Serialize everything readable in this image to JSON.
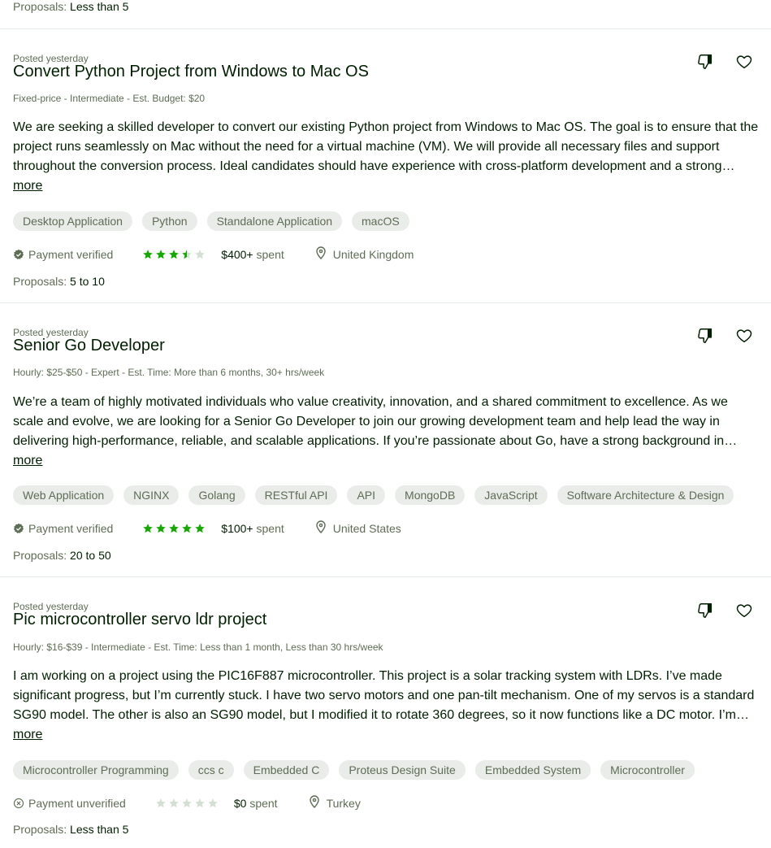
{
  "top": {
    "proposals_label": "Proposals:",
    "proposals_value": "Less than 5"
  },
  "jobs": [
    {
      "posted": "Posted yesterday",
      "title": "Convert Python Project from Windows to Mac OS",
      "meta": "Fixed-price - Intermediate - Est. Budget: $20",
      "description": "We are seeking a skilled developer to convert our existing Python project from Windows to Mac OS. The goal is to ensure that the project runs seamlessly on Mac without the need for a virtual machine (VM). We will provide all necessary files and support throughout the conversion process. Ideal candidates should have experience with cross-platform development and a strong understanding of both operating systems.",
      "more_label": "more",
      "tags": [
        "Desktop Application",
        "Python",
        "Standalone Application",
        "macOS"
      ],
      "payment": "Payment verified",
      "payment_verified": true,
      "rating": 3.5,
      "spent_amount": "$400+",
      "spent_label": "spent",
      "location": "United Kingdom",
      "proposals_label": "Proposals:",
      "proposals_value": "5 to 10"
    },
    {
      "posted": "Posted yesterday",
      "title": "Senior Go Developer",
      "meta": "Hourly: $25-$50 - Expert - Est. Time: More than 6 months, 30+ hrs/week",
      "description": "We’re a team of highly motivated individuals who value creativity, innovation, and a shared commitment to excellence. As we scale and evolve, we are looking for a Senior Go Developer to join our growing development team and help lead the way in delivering high-performance, reliable, and scalable applications. If you’re passionate about Go, have a strong background in building backend services.",
      "more_label": "more",
      "tags": [
        "Web Application",
        "NGINX",
        "Golang",
        "RESTful API",
        "API",
        "MongoDB",
        "JavaScript",
        "Software Architecture & Design"
      ],
      "payment": "Payment verified",
      "payment_verified": true,
      "rating": 5,
      "spent_amount": "$100+",
      "spent_label": "spent",
      "location": "United States",
      "proposals_label": "Proposals:",
      "proposals_value": "20 to 50"
    },
    {
      "posted": "Posted yesterday",
      "title": "Pic microcontroller servo ldr project",
      "meta": "Hourly: $16-$39 - Intermediate - Est. Time: Less than 1 month, Less than 30 hrs/week",
      "description": "I am working on a project using the PIC16F887 microcontroller. This project is a solar tracking system with LDRs. I’ve made significant progress, but I’m currently stuck. I have two servo motors and one pan-tilt mechanism. One of my servos is a standard SG90 model. The other is also an SG90 model, but I modified it to rotate 360 degrees, so it now functions like a DC motor. I’m struggling with the code.",
      "more_label": "more",
      "tags": [
        "Microcontroller Programming",
        "ccs c",
        "Embedded C",
        "Proteus Design Suite",
        "Embedded System",
        "Microcontroller"
      ],
      "payment": "Payment unverified",
      "payment_verified": false,
      "rating": 0,
      "spent_amount": "$0",
      "spent_label": "spent",
      "location": "Turkey",
      "proposals_label": "Proposals:",
      "proposals_value": "Less than 5"
    }
  ],
  "colors": {
    "text": "#001e00",
    "muted": "#5e6d55",
    "star": "#14a800",
    "star_empty": "#d5e0d5",
    "tag_bg": "#e9ece9",
    "divider": "#e4ebe4"
  },
  "icons": {
    "dislike": "thumbs-down-icon",
    "save": "heart-icon",
    "verified": "verified-badge-icon",
    "unverified": "unverified-badge-icon",
    "location": "location-pin-icon",
    "star": "star-icon"
  }
}
